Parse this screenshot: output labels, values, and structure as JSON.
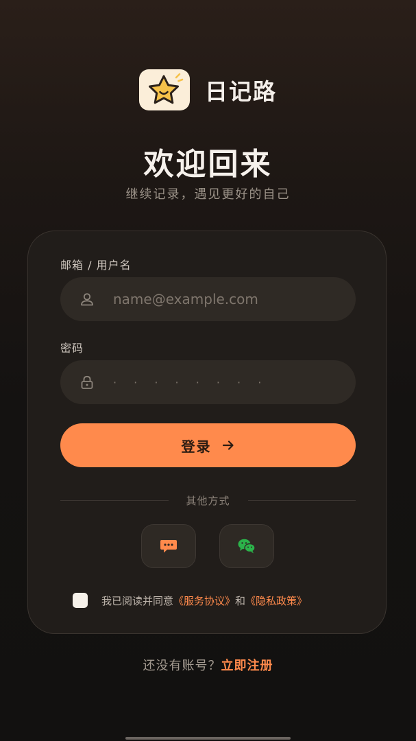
{
  "app": {
    "name": "日记路",
    "logo_icon": "star-face-icon"
  },
  "header": {
    "title": "欢迎回来",
    "subtitle": "继续记录，遇见更好的自己"
  },
  "form": {
    "account_label": "邮箱 / 用户名",
    "account_placeholder": "name@example.com",
    "account_icon": "user-icon",
    "password_label": "密码",
    "password_placeholder": "· · · · · · · ·",
    "password_icon": "lock-icon",
    "login_label": "登录",
    "login_icon": "arrow-right-icon"
  },
  "divider": {
    "text": "其他方式"
  },
  "social": [
    {
      "name": "sms-login",
      "icon": "chat-bubble-icon",
      "color": "#ff8a4c"
    },
    {
      "name": "wechat-login",
      "icon": "wechat-icon",
      "color": "#2bb34a"
    }
  ],
  "agreement": {
    "checked": false,
    "prefix": "我已阅读并同意",
    "terms_link": "《服务协议》",
    "connector": "和",
    "privacy_link": "《隐私政策》"
  },
  "footer": {
    "prompt": "还没有账号？",
    "signup_link": "立即注册"
  },
  "colors": {
    "accent": "#ff8a4c",
    "card_bg": "#211d1a",
    "field_bg": "#2f2a25",
    "logo_bg": "#fbeed9",
    "star": "#f6c24a"
  }
}
